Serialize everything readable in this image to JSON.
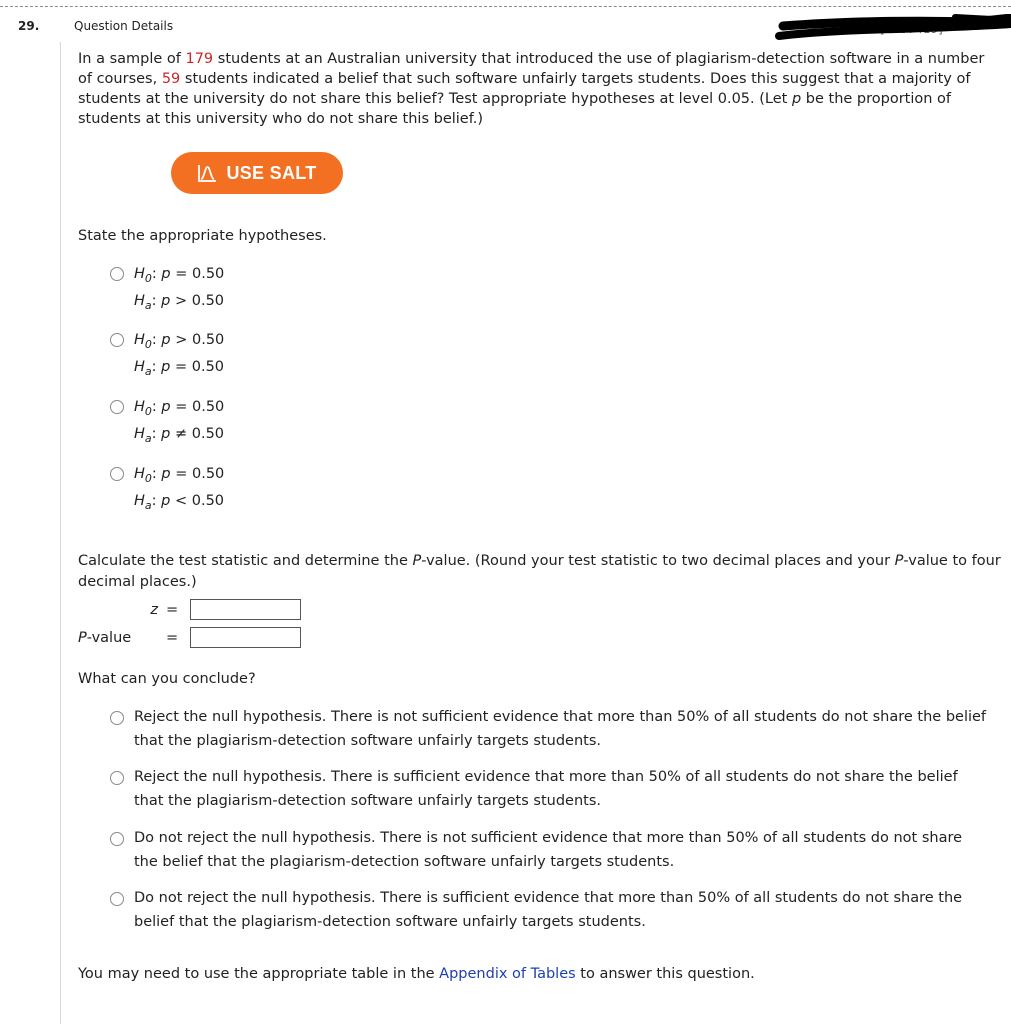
{
  "question": {
    "number": "29.",
    "details_label": "Question Details",
    "redacted_id": "[4757419]",
    "intro_parts": [
      {
        "text": "In a sample of ",
        "highlight": false
      },
      {
        "text": "179",
        "highlight": true
      },
      {
        "text": " students at an Australian university that introduced the use of plagiarism-detection software in a number of courses, ",
        "highlight": false
      },
      {
        "text": "59",
        "highlight": true
      },
      {
        "text": " students indicated a belief that such software unfairly targets students. Does this suggest that a majority of students at the university do not share this belief? Test appropriate hypotheses at level 0.05. (Let ",
        "highlight": false
      },
      {
        "text": "p",
        "italic": true
      },
      {
        "text": " be the proportion of students at this university who do not share this belief.)",
        "highlight": false
      }
    ],
    "sample_size": "179",
    "count": "59",
    "highlight_color": "#c62828"
  },
  "salt_button": {
    "label": "USE SALT",
    "icon": "salt-distribution-icon",
    "color": "#f36f21"
  },
  "hypotheses": {
    "prompt": "State the appropriate hypotheses.",
    "options": [
      {
        "h0": ": p = 0.50",
        "ha": ": p > 0.50",
        "h0_rel": "=",
        "ha_rel": ">"
      },
      {
        "h0": ": p > 0.50",
        "ha": ": p = 0.50",
        "h0_rel": ">",
        "ha_rel": "="
      },
      {
        "h0": ": p = 0.50",
        "ha": ": p ≠ 0.50",
        "h0_rel": "=",
        "ha_rel": "≠"
      },
      {
        "h0": ": p = 0.50",
        "ha": ": p < 0.50",
        "h0_rel": "=",
        "ha_rel": "<"
      }
    ],
    "value": "0.50"
  },
  "calculation": {
    "prompt_a": "Calculate the test statistic and determine the ",
    "prompt_p": "P",
    "prompt_b": "-value. (Round your test statistic to two decimal places and your ",
    "prompt_c": "-value to four decimal places.)",
    "z_label": "z",
    "pvalue_label_p": "P",
    "pvalue_label_rest": "-value",
    "equals": "=",
    "z_value": "",
    "p_value": ""
  },
  "conclusion": {
    "prompt": "What can you conclude?",
    "options": [
      "Reject the null hypothesis. There is not sufficient evidence that more than 50% of all students do not share the belief that the plagiarism-detection software unfairly targets students.",
      "Reject the null hypothesis. There is sufficient evidence that more than 50% of all students do not share the belief that the plagiarism-detection software unfairly targets students.",
      "Do not reject the null hypothesis. There is not sufficient evidence that more than 50% of all students do not share the belief that the plagiarism-detection software unfairly targets students.",
      "Do not reject the null hypothesis. There is sufficient evidence that more than 50% of all students do not share the belief that the plagiarism-detection software unfairly targets students."
    ]
  },
  "footer": {
    "before": "You may need to use the appropriate table in the ",
    "link": "Appendix of Tables",
    "after": " to answer this question.",
    "link_color": "#1e3fb0"
  }
}
